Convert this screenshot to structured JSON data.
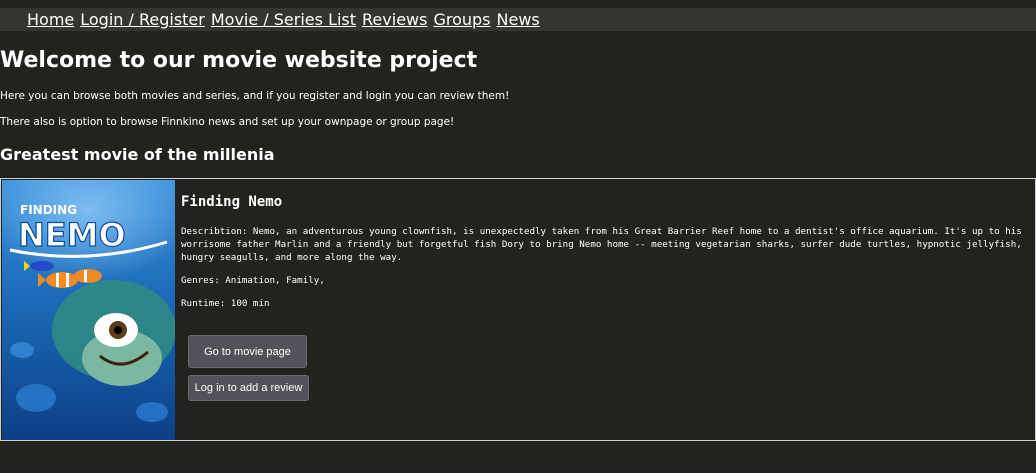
{
  "nav": {
    "items": [
      {
        "label": "Home"
      },
      {
        "label": "Login / Register"
      },
      {
        "label": "Movie / Series List"
      },
      {
        "label": "Reviews"
      },
      {
        "label": "Groups"
      },
      {
        "label": "News"
      }
    ]
  },
  "hero": {
    "title": "Welcome to our movie website project",
    "intro_1": "Here you can browse both movies and series, and if you register and login you can review them!",
    "intro_2": "There also is option to browse Finnkino news and set up your ownpage or group page!"
  },
  "featured": {
    "section_title": "Greatest movie of the millenia",
    "poster_text_top": "FINDING",
    "poster_text_bottom": "NEMO",
    "title": "Finding Nemo",
    "description": "Describtion: Nemo, an adventurous young clownfish, is unexpectedly taken from his Great Barrier Reef home to a dentist's office aquarium. It's up to his worrisome father Marlin and a friendly but forgetful fish Dory to bring Nemo home -- meeting vegetarian sharks, surfer dude turtles, hypnotic jellyfish, hungry seagulls, and more along the way.",
    "genres": "Genres: Animation, Family,",
    "runtime": "Runtime: 100 min",
    "movie_button": "Go to movie page",
    "review_button": "Log in to add a review"
  },
  "colors": {
    "background": "#22231f",
    "navbar": "#34352f",
    "button": "#51525a",
    "poster_blue": "#1c6bb8"
  }
}
